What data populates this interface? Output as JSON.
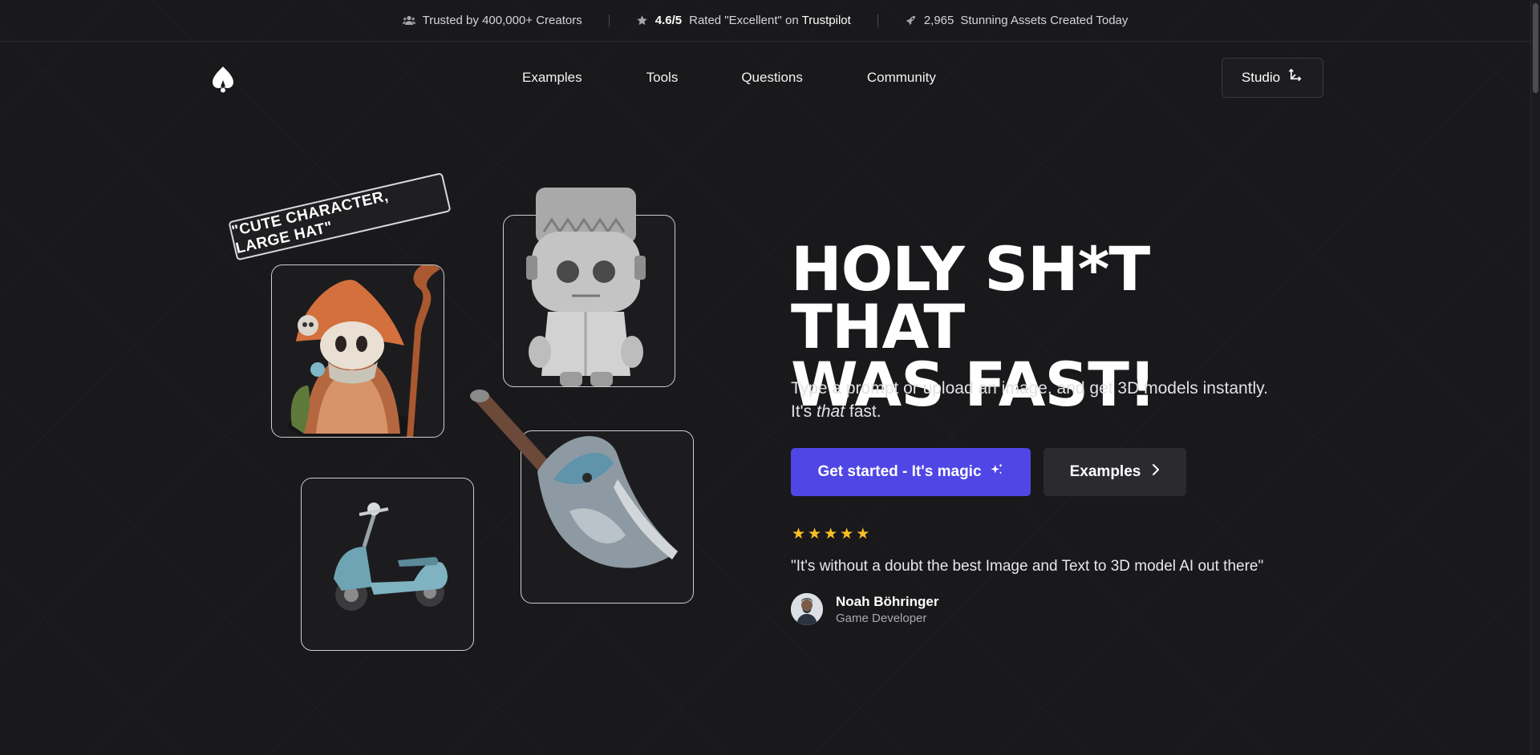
{
  "topbar": {
    "trusted": "Trusted by 400,000+ Creators",
    "rating_value": "4.6/5",
    "rating_text": "Rated \"Excellent\" on",
    "trustpilot": "Trustpilot",
    "assets_count": "2,965",
    "assets_text": "Stunning Assets Created Today",
    "icons": [
      "users-icon",
      "star-icon",
      "rocket-icon"
    ]
  },
  "nav": {
    "links": [
      "Examples",
      "Tools",
      "Questions",
      "Community"
    ],
    "studio_label": "Studio"
  },
  "showcase": {
    "tag_text": "\"CUTE CHARACTER, LARGE HAT\""
  },
  "hero": {
    "headline_line1": "HOLY SH*T THAT",
    "headline_line2": "WAS FAST!",
    "sub_line1": "Type a prompt or upload an image, and get 3D models instantly.",
    "sub_line2_pre": "It's ",
    "sub_line2_em": "that",
    "sub_line2_post": " fast.",
    "cta_primary": "Get started - It's magic",
    "cta_secondary": "Examples",
    "stars": 5,
    "quote": "\"It's without a doubt the best Image and Text to 3D model AI out there\"",
    "author_name": "Noah Böhringer",
    "author_role": "Game Developer"
  },
  "colors": {
    "background": "#19191b",
    "primary": "#4f46e5",
    "star": "#fbbf24",
    "secondary_button": "#2b2b2f"
  }
}
